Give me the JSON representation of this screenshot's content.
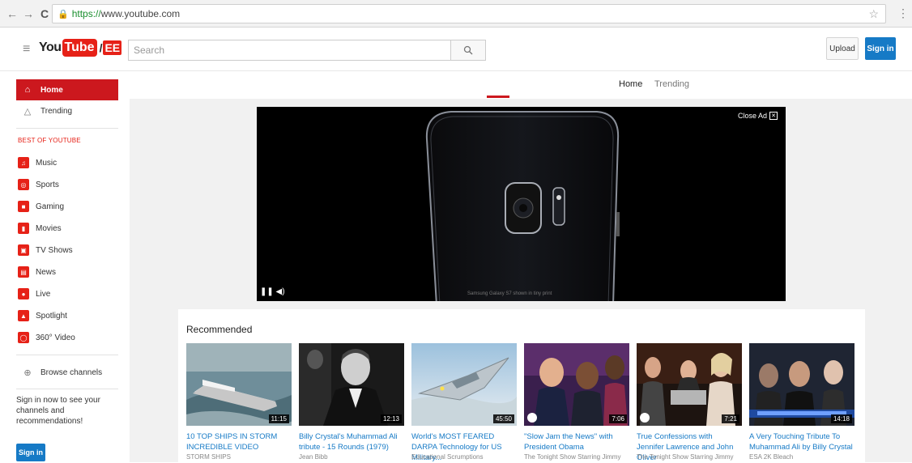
{
  "browser": {
    "url_scheme": "https://",
    "url_rest": "www.youtube.com"
  },
  "header": {
    "logo_you": "You",
    "logo_tube": "Tube",
    "logo_region": "EE",
    "search_placeholder": "Search",
    "upload_label": "Upload",
    "signin_label": "Sign in"
  },
  "sidebar": {
    "home": "Home",
    "trending": "Trending",
    "best_heading": "BEST OF YOUTUBE",
    "categories": [
      {
        "label": "Music",
        "icon": "music-icon"
      },
      {
        "label": "Sports",
        "icon": "sports-icon"
      },
      {
        "label": "Gaming",
        "icon": "gaming-icon"
      },
      {
        "label": "Movies",
        "icon": "movies-icon"
      },
      {
        "label": "TV Shows",
        "icon": "tv-icon"
      },
      {
        "label": "News",
        "icon": "news-icon"
      },
      {
        "label": "Live",
        "icon": "live-icon"
      },
      {
        "label": "Spotlight",
        "icon": "spotlight-icon"
      },
      {
        "label": "360° Video",
        "icon": "360-icon"
      }
    ],
    "browse_channels": "Browse channels",
    "signin_note": "Sign in now to see your channels and recommendations!",
    "signin_button": "Sign in"
  },
  "tabs": {
    "home": "Home",
    "trending": "Trending"
  },
  "player": {
    "close_ad": "Close Ad",
    "caption": "Samsung Galaxy S7 shown in tiny print"
  },
  "recommended": {
    "title": "Recommended",
    "videos": [
      {
        "title": "10 TOP SHIPS IN STORM INCREDIBLE VIDEO",
        "channel": "STORM SHIPS",
        "duration": "11:15"
      },
      {
        "title": "Billy Crystal's Muhammad Ali tribute - 15 Rounds (1979)",
        "channel": "Jean Bibb",
        "duration": "12:13"
      },
      {
        "title": "World's MOST FEARED DARPA Technology for US Military...",
        "channel": "Educational Scrumptions",
        "duration": "45:50"
      },
      {
        "title": "\"Slow Jam the News\" with President Obama",
        "channel": "The Tonight Show Starring Jimmy",
        "duration": "7:06"
      },
      {
        "title": "True Confessions with Jennifer Lawrence and John Oliver",
        "channel": "The Tonight Show Starring Jimmy",
        "duration": "7:21"
      },
      {
        "title": "A Very Touching Tribute To Muhammad Ali by Billy Crystal",
        "channel": "ESA 2K Bleach",
        "duration": "14:18"
      }
    ]
  },
  "colors": {
    "brand_red": "#cc181e",
    "link_blue": "#167ac6"
  }
}
